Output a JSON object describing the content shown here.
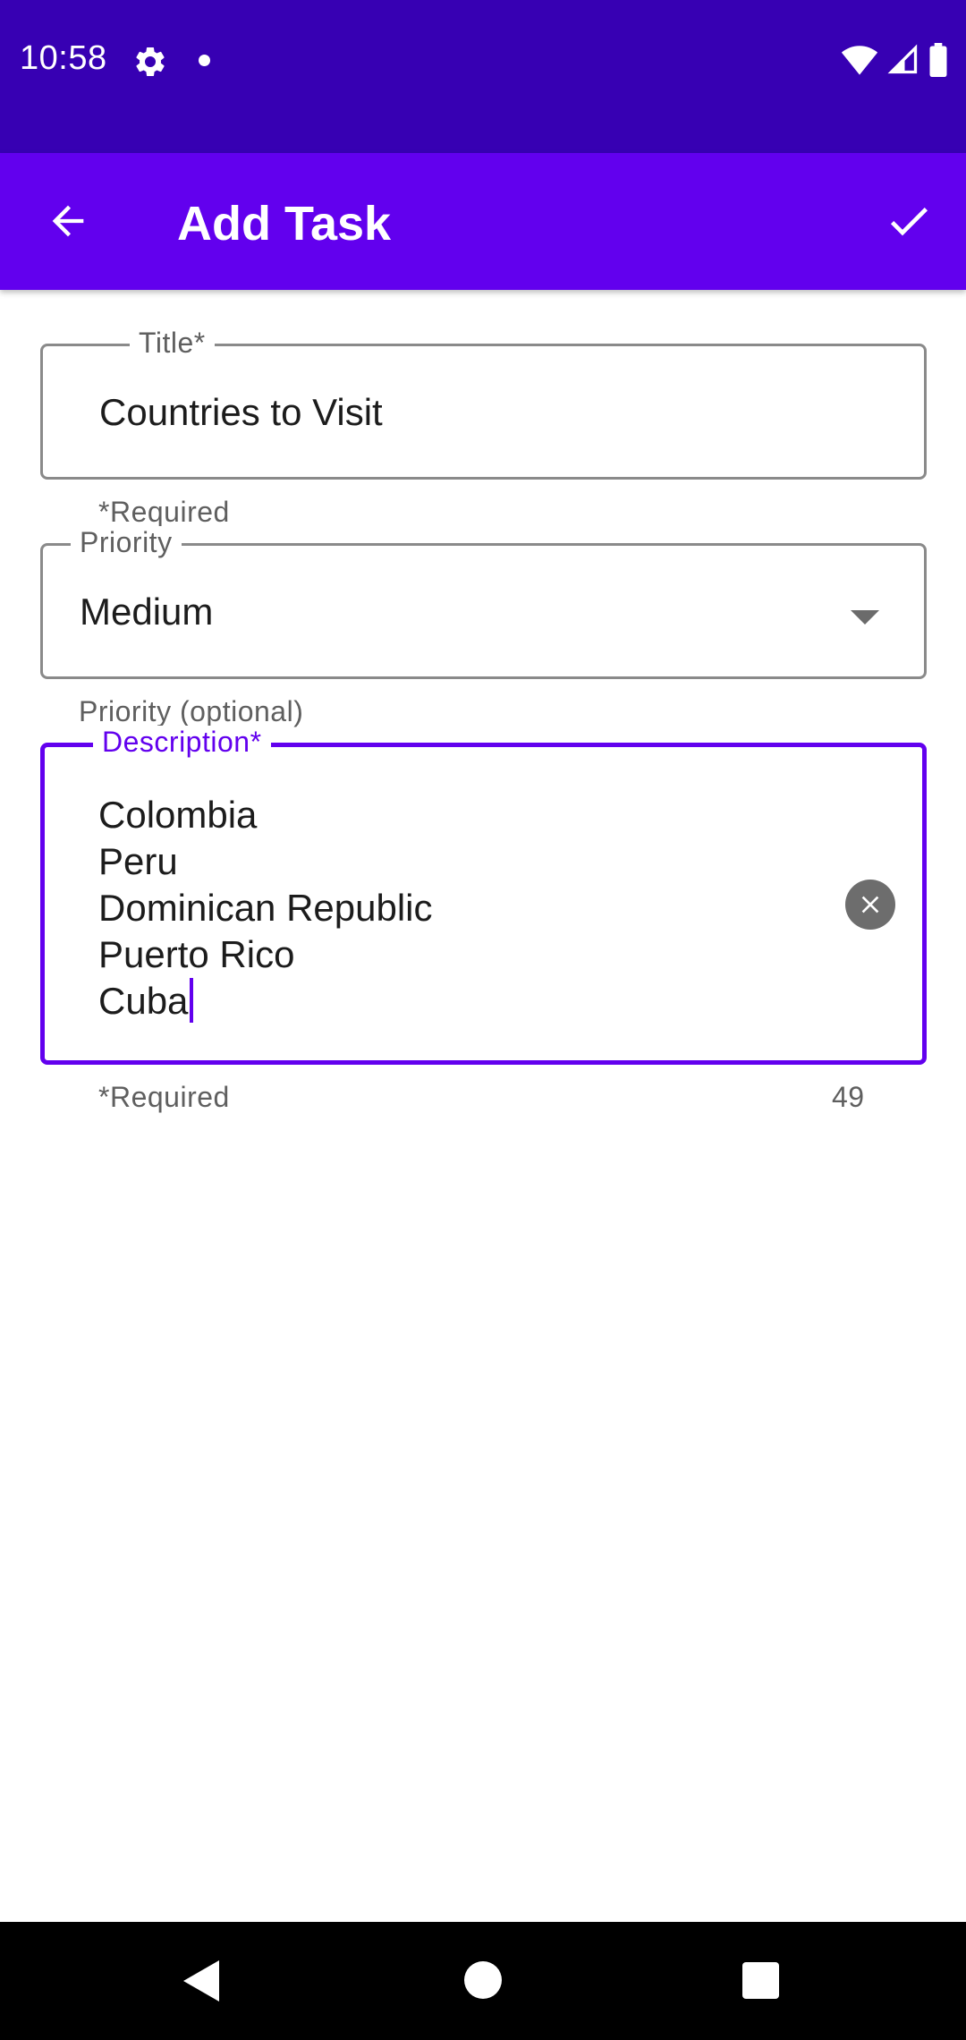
{
  "status_bar": {
    "time": "10:58",
    "icons": [
      "settings-icon",
      "notification-dot-icon",
      "wifi-icon",
      "signal-icon",
      "battery-icon"
    ]
  },
  "app_bar": {
    "title": "Add Task",
    "back_icon": "arrow-back-icon",
    "save_icon": "check-icon"
  },
  "form": {
    "title_field": {
      "label": "Title*",
      "value": "Countries to Visit",
      "helper": "*Required"
    },
    "priority_field": {
      "label": "Priority",
      "value": "Medium",
      "helper": "Priority (optional)"
    },
    "description_field": {
      "label": "Description*",
      "lines": [
        "Colombia",
        "Peru",
        "Dominican Republic",
        "Puerto Rico",
        "Cuba"
      ],
      "helper": "*Required",
      "counter": "49"
    }
  },
  "colors": {
    "status_bar": "#3700b3",
    "app_bar": "#6200ee",
    "accent": "#6200ee"
  },
  "nav_bar": {
    "icons": [
      "nav-back-icon",
      "nav-home-icon",
      "nav-recents-icon"
    ]
  }
}
